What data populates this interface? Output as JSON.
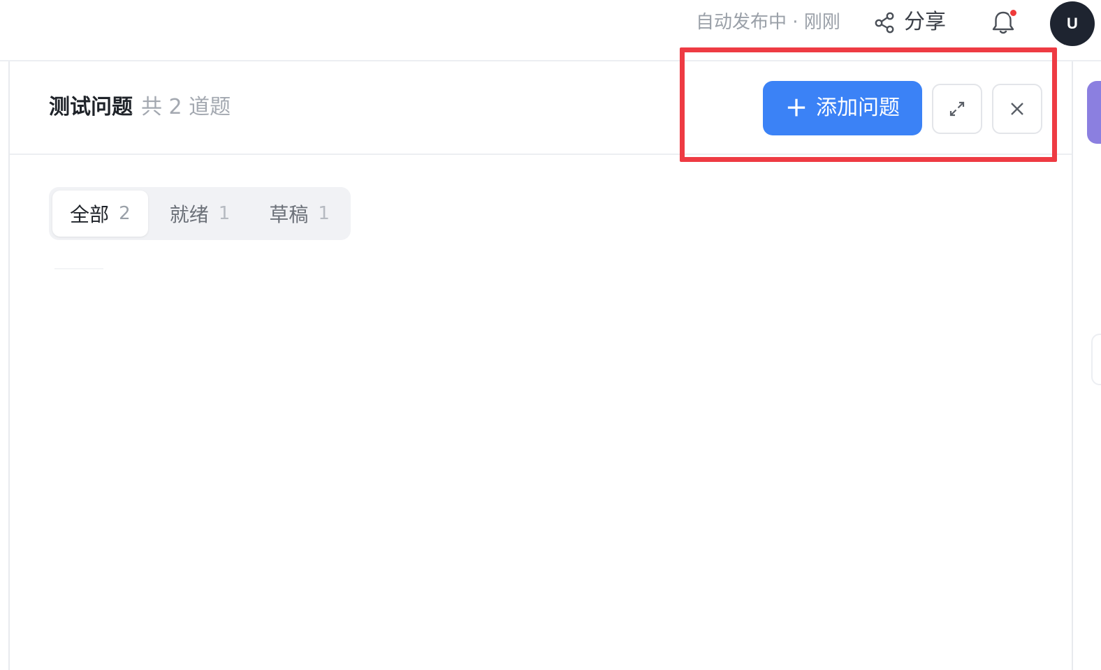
{
  "topbar": {
    "autosave_status": "自动发布中 · 刚刚",
    "share_label": "分享",
    "avatar_initial": "U",
    "notification_dot": true
  },
  "panel": {
    "title": "测试问题",
    "count_text": "共 2 道题",
    "add_button_label": "添加问题",
    "add_button_icon": "plus-icon",
    "expand_icon": "expand-icon",
    "close_icon": "close-icon"
  },
  "tabs": [
    {
      "label": "全部",
      "count": "2",
      "active": true
    },
    {
      "label": "就绪",
      "count": "1",
      "active": false
    },
    {
      "label": "草稿",
      "count": "1",
      "active": false
    }
  ],
  "colors": {
    "primary": "#3b82f6",
    "highlight": "#ee3b43",
    "notification": "#ef3a3a",
    "avatar_bg": "#1e2430"
  }
}
